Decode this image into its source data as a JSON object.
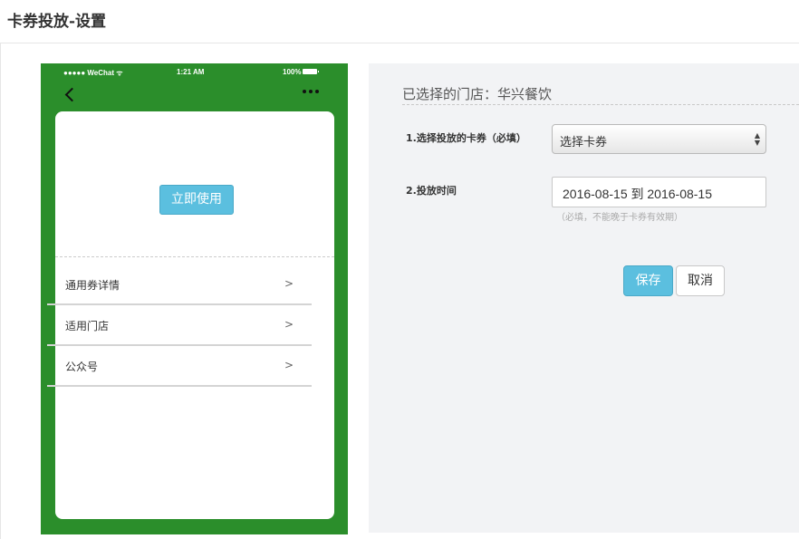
{
  "page": {
    "title": "卡券投放-设置"
  },
  "phone": {
    "status": {
      "carrier": "●●●●● WeChat ᯤ",
      "time": "1:21 AM",
      "battery": "100%"
    },
    "icons": {
      "back": "chevron-left-icon",
      "more": "more-dots-icon",
      "battery": "battery-icon"
    },
    "use_button": "立即使用",
    "menu": [
      {
        "label": "通用券详情",
        "arrow": ">"
      },
      {
        "label": "适用门店",
        "arrow": ">"
      },
      {
        "label": "公众号",
        "arrow": ">"
      }
    ],
    "colors": {
      "background": "#2b8e2b",
      "button": "#5bbfdf"
    }
  },
  "panel": {
    "store_heading": "已选择的门店：华兴餐饮",
    "field1_label": "1.选择投放的卡券（必填）",
    "field1_value": "选择卡券",
    "field2_label": "2.投放时间",
    "field2_value": "2016-08-15 到 2016-08-15",
    "field2_hint": "（必填，不能晚于卡券有效期）",
    "save_label": "保存",
    "cancel_label": "取消",
    "colors": {
      "primary": "#5bbfdf",
      "background": "#f2f3f5"
    }
  }
}
